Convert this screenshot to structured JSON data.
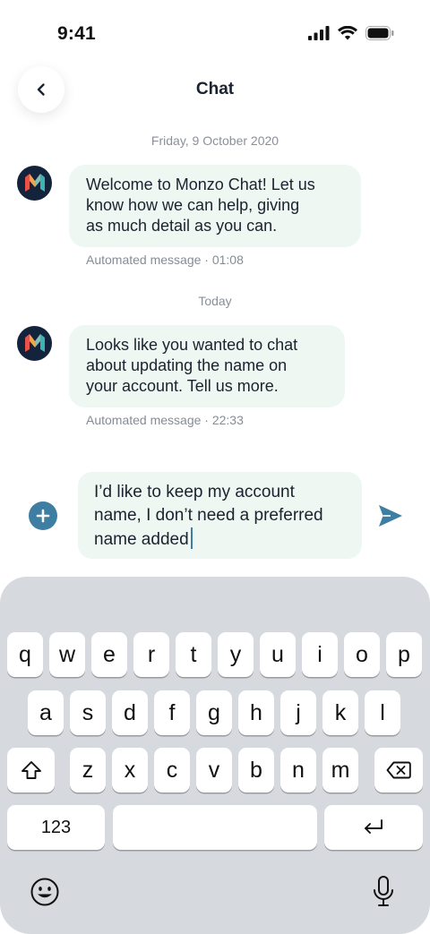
{
  "status_bar": {
    "time": "9:41"
  },
  "header": {
    "title": "Chat"
  },
  "messages": [
    {
      "date": "Friday, 9 October 2020",
      "text": "Welcome to Monzo Chat! Let us know how we can help, giving as much detail as you can.",
      "lines": [
        "Welcome to Monzo Chat! Let us",
        "know how we can help, giving",
        "as much detail as you can."
      ],
      "meta": "Automated message · 01:08"
    },
    {
      "date": "Today",
      "text": "Looks like you wanted to chat about updating the name on your account. Tell us more.",
      "lines": [
        "Looks like you wanted to chat",
        "about updating the name on",
        "your account. Tell us more."
      ],
      "meta": "Automated message · 22:33"
    }
  ],
  "composer": {
    "value": "I’d like to keep my account name, I don’t need a preferred name added",
    "lines": [
      "I’d like to keep my account",
      "name, I don’t need a preferred",
      "name added"
    ]
  },
  "keyboard": {
    "row1": [
      "q",
      "w",
      "e",
      "r",
      "t",
      "y",
      "u",
      "i",
      "o",
      "p"
    ],
    "row2": [
      "a",
      "s",
      "d",
      "f",
      "g",
      "h",
      "j",
      "k",
      "l"
    ],
    "row3": [
      "z",
      "x",
      "c",
      "v",
      "b",
      "n",
      "m"
    ],
    "numbers_label": "123"
  },
  "icons": {
    "back": "chevron-left-icon",
    "add": "plus-icon",
    "send": "send-icon",
    "shift": "shift-icon",
    "delete": "backspace-icon",
    "return": "return-icon",
    "emoji": "emoji-icon",
    "mic": "microphone-icon"
  },
  "colors": {
    "bubble": "#eef7f1",
    "accent": "#3f7ea3",
    "keyboard_bg": "#d6d9de",
    "avatar_bg": "#14233c"
  }
}
